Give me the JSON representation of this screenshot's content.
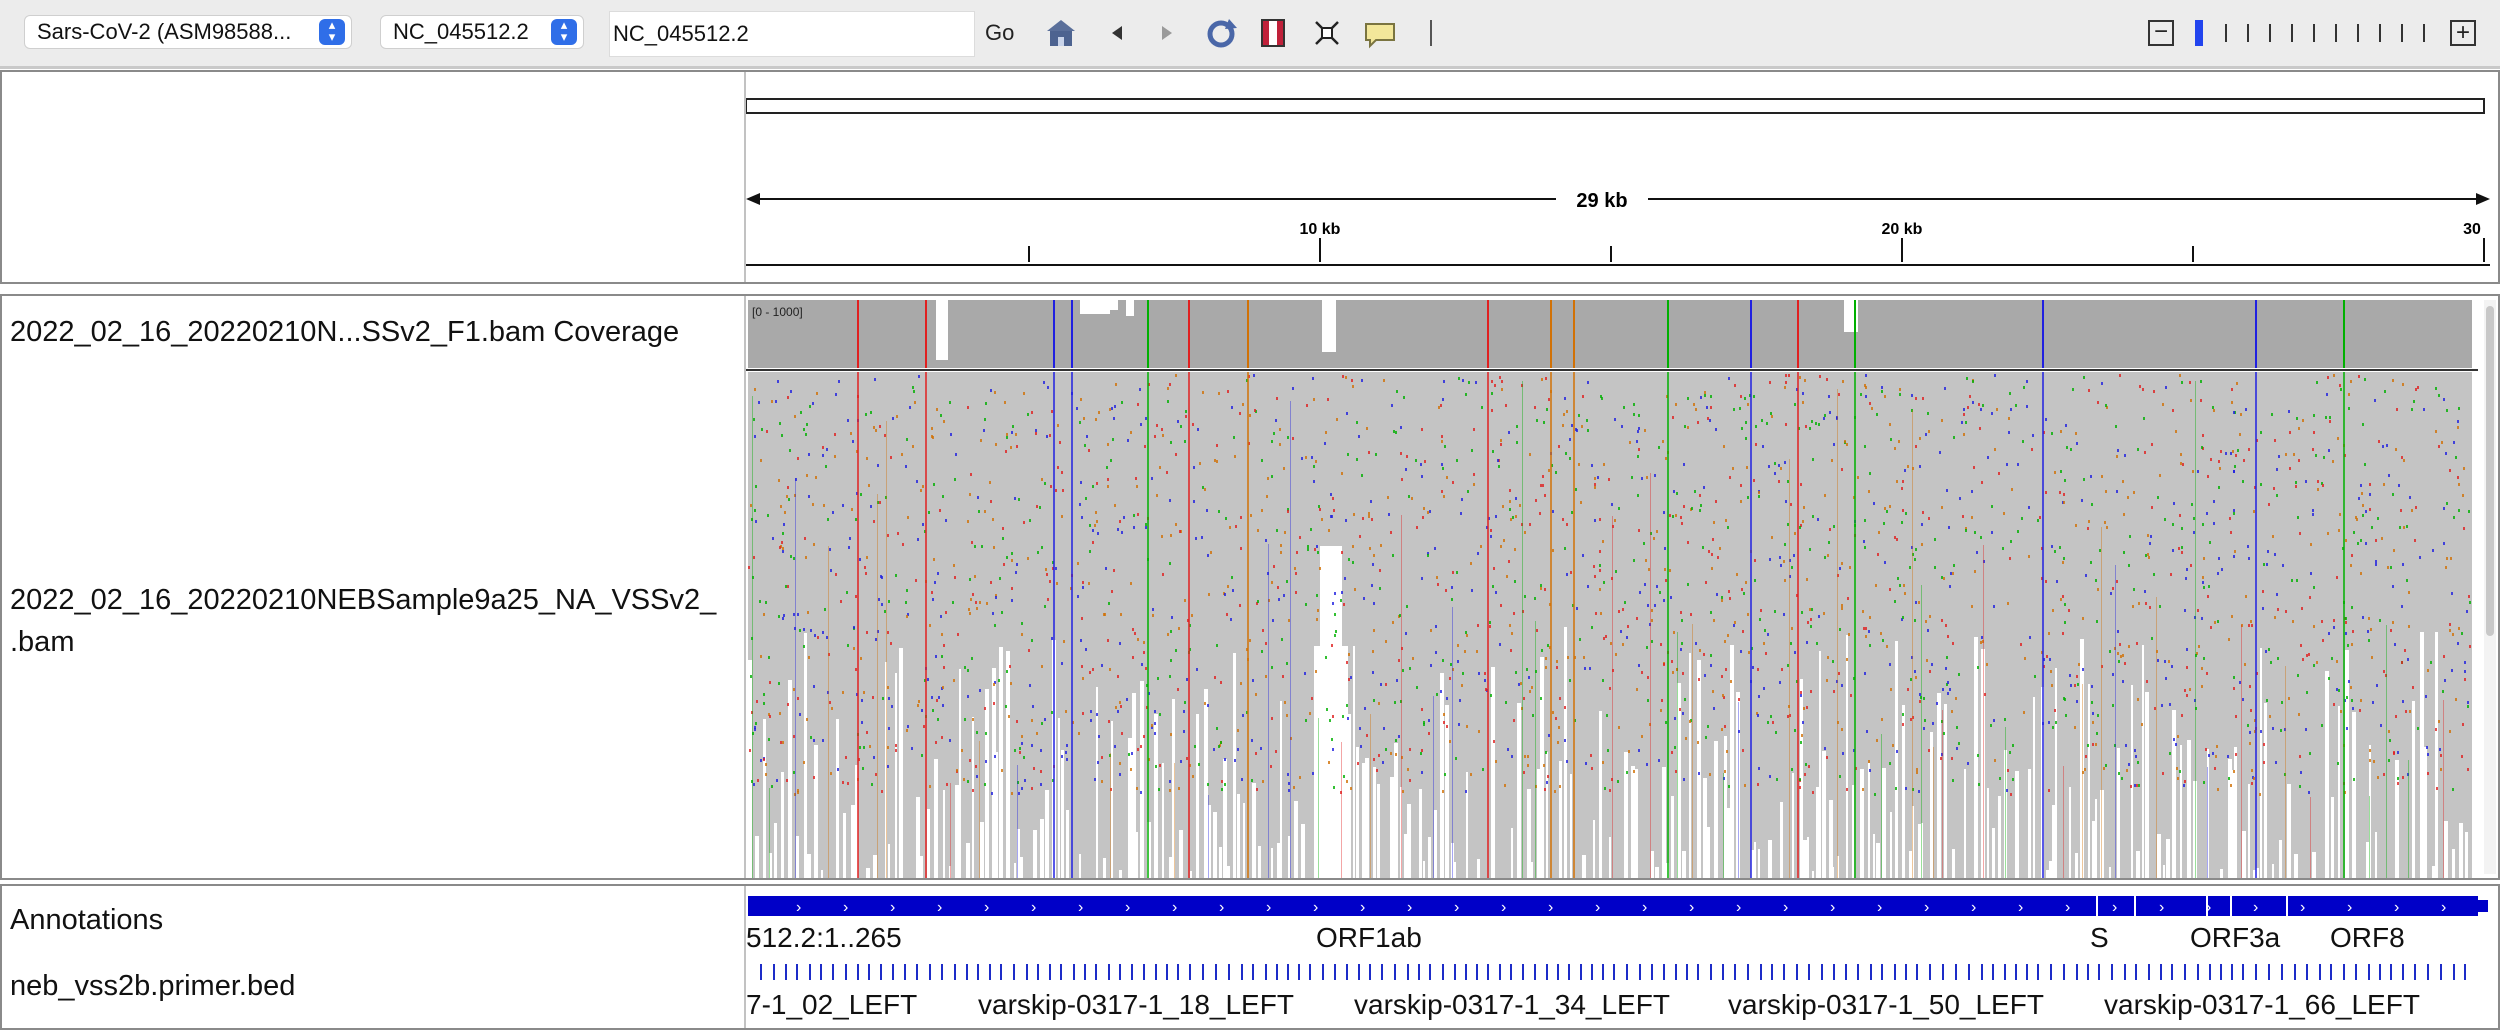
{
  "toolbar": {
    "genome": "Sars-CoV-2 (ASM98588...",
    "chromosome": "NC_045512.2",
    "locus": "NC_045512.2",
    "go": "Go",
    "icons": [
      "home-icon",
      "back-icon",
      "forward-icon",
      "refresh-icon",
      "roi-icon",
      "fit-window-icon",
      "popup-text-icon"
    ],
    "zoom_out": "−",
    "zoom_in": "+"
  },
  "ruler": {
    "span": "29 kb",
    "ticks": [
      "10 kb",
      "20 kb",
      "30"
    ]
  },
  "tracks": {
    "coverage_label": "2022_02_16_20220210N...SSv2_F1.bam Coverage",
    "coverage_range": "[0 - 1000]",
    "alignment_label_line1": "2022_02_16_20220210NEBSample9a25_NA_VSSv2_",
    "alignment_label_line2": ".bam",
    "annotations_label": "Annotations",
    "primer_label": "neb_vss2b.primer.bed"
  },
  "genes": [
    "512.2:1..265",
    "ORF1ab",
    "S",
    "ORF3a",
    "ORF8"
  ],
  "primers": [
    "7-1_02_LEFT",
    "varskip-0317-1_18_LEFT",
    "varskip-0317-1_34_LEFT",
    "varskip-0317-1_50_LEFT",
    "varskip-0317-1_66_LEFT"
  ],
  "colors": {
    "coverage_gray": "#a9a9a9",
    "read_gray": "#c4c4c4",
    "gene_blue": "#0000c8",
    "base_A": "#00b000",
    "base_C": "#2020e0",
    "base_G": "#d17105",
    "base_T": "#e02020"
  }
}
